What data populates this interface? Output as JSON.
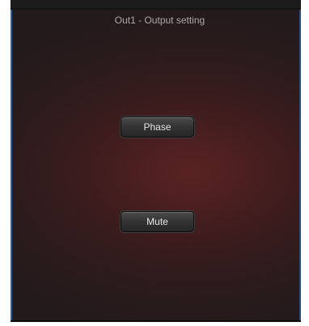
{
  "window": {
    "title": "Out1 - Output setting"
  },
  "buttons": {
    "phase_label": "Phase",
    "mute_label": "Mute"
  },
  "colors": {
    "panel_background": "#3c1c1d",
    "panel_glow": "#5a2222",
    "frame_accent": "#2f5f9a",
    "button_face": "#353535",
    "button_text": "#e6e6e6",
    "title_text": "#a9a9a9"
  }
}
